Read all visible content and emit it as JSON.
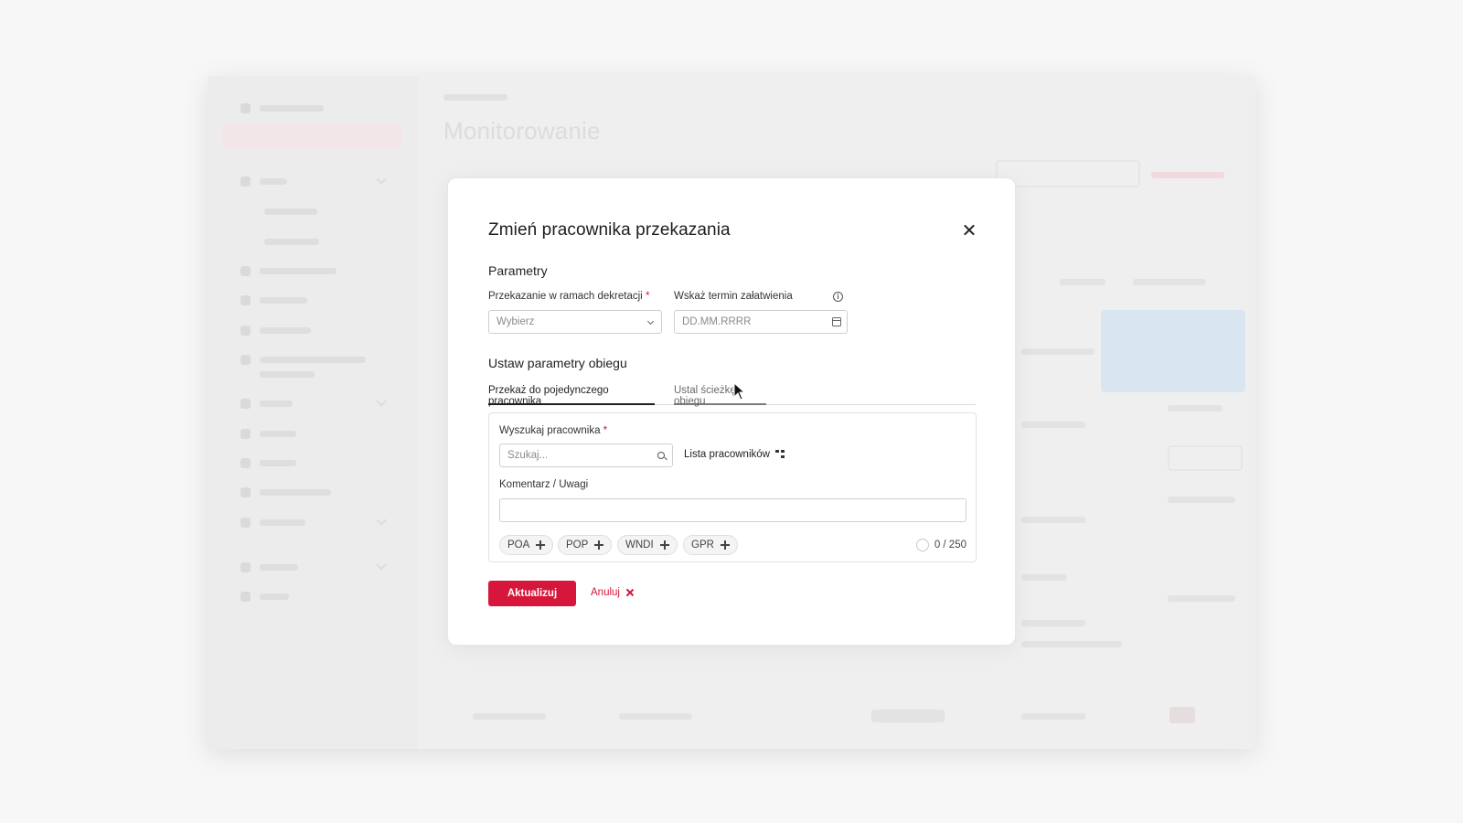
{
  "modal": {
    "title": "Zmień pracownika przekazania",
    "parameters": {
      "section_title": "Parametry",
      "decree_label": "Przekazanie w ramach dekretacji",
      "decree_required": "*",
      "decree_value": "Wybierz",
      "deadline_label": "Wskaż termin załatwienia",
      "deadline_placeholder": "DD.MM.RRRR",
      "info_glyph": "i"
    },
    "flow": {
      "section_title": "Ustaw parametry obiegu",
      "tabs": [
        {
          "label": "Przekaż do pojedynczego pracownika",
          "active": true
        },
        {
          "label": "Ustal ścieżkę obiegu",
          "active": false
        }
      ],
      "employee_search_label": "Wyszukaj pracownika",
      "employee_search_required": "*",
      "employee_search_placeholder": "Szukaj...",
      "employee_list_link": "Lista pracowników",
      "comment_label": "Komentarz / Uwagi",
      "chips": [
        "POA",
        "POP",
        "WNDI",
        "GPR"
      ],
      "char_counter": "0 / 250"
    },
    "actions": {
      "submit_label": "Aktualizuj",
      "cancel_label": "Anuluj"
    }
  },
  "background": {
    "page_title": "Monitorowanie"
  },
  "colors": {
    "accent": "#d6163b",
    "text": "#1f1f1f",
    "border": "#cfcfcf"
  },
  "icons": [
    "close-icon",
    "chevron-down-icon",
    "calendar-icon",
    "info-icon",
    "search-icon",
    "org-tree-icon",
    "plus-icon",
    "ring-progress-icon",
    "cancel-x-icon",
    "mouse-cursor-icon"
  ]
}
